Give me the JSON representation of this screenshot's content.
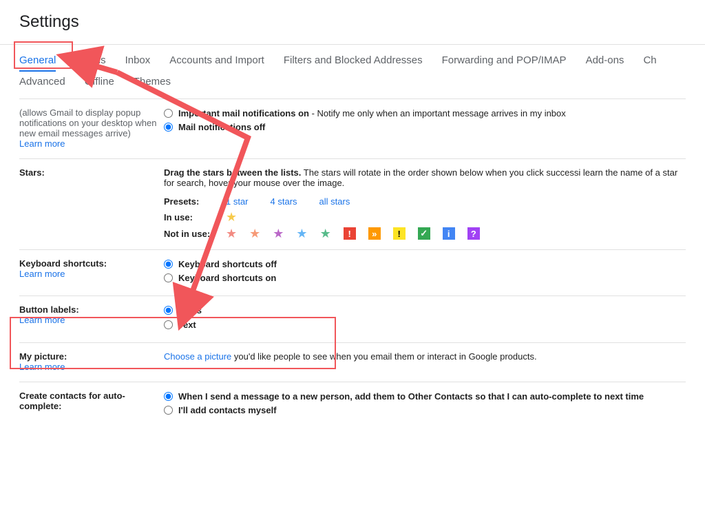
{
  "page_title": "Settings",
  "tabs": [
    "General",
    "Labels",
    "Inbox",
    "Accounts and Import",
    "Filters and Blocked Addresses",
    "Forwarding and POP/IMAP",
    "Add-ons",
    "Ch"
  ],
  "tabs2": [
    "Advanced",
    "Offline",
    "Themes"
  ],
  "active_tab": "General",
  "notifications": {
    "desc": "(allows Gmail to display popup notifications on your desktop when new email messages arrive)",
    "learn": "Learn more",
    "opt1_bold": "Important mail notifications on",
    "opt1_rest": " - Notify me only when an important message arrives in my inbox",
    "opt2_bold": "Mail notifications off"
  },
  "stars": {
    "label": "Stars:",
    "drag_bold": "Drag the stars between the lists.",
    "drag_rest": "  The stars will rotate in the order shown below when you click successi learn the name of a star for search, hover your mouse over the image.",
    "presets_label": "Presets:",
    "presets": [
      "1 star",
      "4 stars",
      "all stars"
    ],
    "inuse_label": "In use:",
    "notinuse_label": "Not in use:",
    "inuse_items": [
      {
        "glyph": "★",
        "color": "#f7cb4d",
        "type": "star"
      }
    ],
    "notinuse_items": [
      {
        "glyph": "★",
        "color": "#f28b82",
        "type": "star"
      },
      {
        "glyph": "★",
        "color": "#f69a77",
        "type": "star"
      },
      {
        "glyph": "★",
        "color": "#ba68c8",
        "type": "star"
      },
      {
        "glyph": "★",
        "color": "#64b5f6",
        "type": "star"
      },
      {
        "glyph": "★",
        "color": "#57bb8a",
        "type": "star"
      },
      {
        "glyph": "!",
        "bg": "#ea4335",
        "type": "sq"
      },
      {
        "glyph": "»",
        "bg": "#fe9900",
        "type": "sq"
      },
      {
        "glyph": "!",
        "bg": "#fde425",
        "fg": "#000",
        "type": "sq"
      },
      {
        "glyph": "✓",
        "bg": "#34a853",
        "type": "sq"
      },
      {
        "glyph": "i",
        "bg": "#4285f4",
        "type": "sq"
      },
      {
        "glyph": "?",
        "bg": "#a142f4",
        "type": "sq"
      }
    ]
  },
  "kbshortcuts": {
    "label": "Keyboard shortcuts:",
    "learn": "Learn more",
    "opt_off": "Keyboard shortcuts off",
    "opt_on": "Keyboard shortcuts on"
  },
  "buttonlabels": {
    "label": "Button labels:",
    "learn": "Learn more",
    "opt1": "Icons",
    "opt2": "Text"
  },
  "mypicture": {
    "label": "My picture:",
    "learn": "Learn more",
    "link": "Choose a picture",
    "rest": " you'd like people to see when you email them or interact in Google products."
  },
  "contacts": {
    "label": "Create contacts for auto-complete:",
    "opt1": "When I send a message to a new person, add them to Other Contacts so that I can auto-complete to next time",
    "opt2": "I'll add contacts myself"
  }
}
